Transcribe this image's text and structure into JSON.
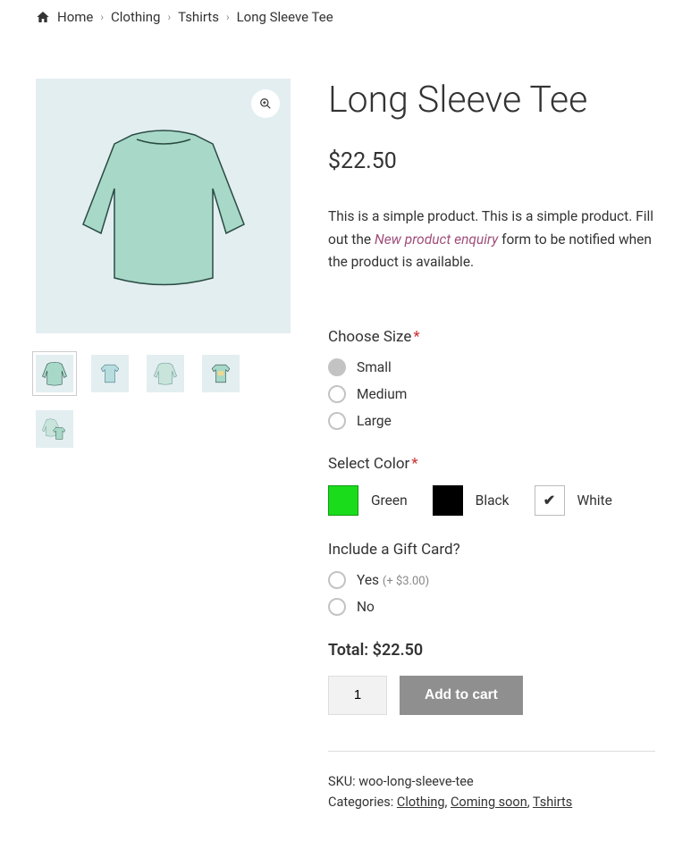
{
  "breadcrumb": {
    "home": "Home",
    "clothing": "Clothing",
    "tshirts": "Tshirts",
    "current": "Long Sleeve Tee"
  },
  "product": {
    "title": "Long Sleeve Tee",
    "price": "$22.50",
    "desc_pre": "This is a simple product. This is a simple product. Fill out the ",
    "desc_link": "New product enquiry",
    "desc_post": " form to be notified when the product is available."
  },
  "size": {
    "label": "Choose Size",
    "opts": {
      "small": "Small",
      "medium": "Medium",
      "large": "Large"
    }
  },
  "color": {
    "label": "Select Color",
    "opts": {
      "green": "Green",
      "black": "Black",
      "white": "White"
    },
    "hex": {
      "green": "#1bdc1b",
      "black": "#000000"
    }
  },
  "gift": {
    "label": "Include a Gift Card?",
    "yes": "Yes",
    "yes_price": "(+ $3.00)",
    "no": "No"
  },
  "total": {
    "label": "Total: ",
    "value": "$22.50"
  },
  "cart": {
    "qty": "1",
    "button": "Add to cart"
  },
  "meta": {
    "sku_label": "SKU: ",
    "sku": "woo-long-sleeve-tee",
    "cat_label": "Categories: ",
    "cats": {
      "clothing": "Clothing",
      "coming": "Coming soon",
      "tshirts": "Tshirts"
    }
  }
}
